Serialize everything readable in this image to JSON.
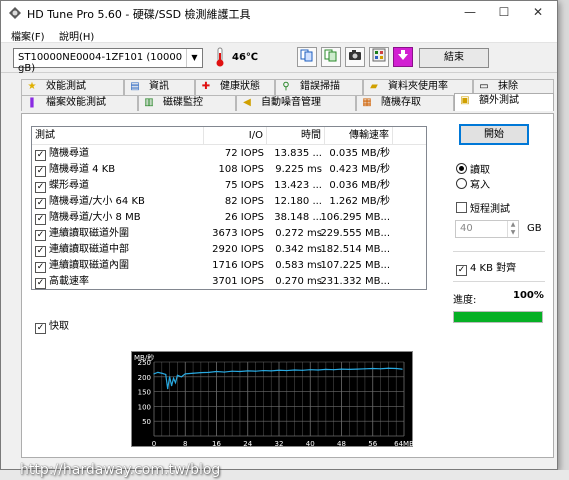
{
  "window": {
    "title": "HD Tune Pro 5.60 - 硬碟/SSD 檢測維護工具",
    "app_icon": "hdtune-icon",
    "caption_buttons": [
      "—",
      "☐",
      "✕"
    ]
  },
  "menu": [
    "檔案(F)",
    "說明(H)"
  ],
  "toolbar": {
    "drive": "ST10000NE0004-1ZF101 (10000 gB)",
    "temperature": "46℃",
    "icons": [
      "copy-info-icon",
      "copy-screenshot-icon",
      "camera-icon",
      "options-icon",
      "save-download-icon"
    ],
    "exit_label": "結束"
  },
  "tabs_row1": [
    {
      "label": "效能測試",
      "icon": "benchmark-icon"
    },
    {
      "label": "資訊",
      "icon": "info-icon"
    },
    {
      "label": "健康狀態",
      "icon": "health-icon"
    },
    {
      "label": "錯誤掃描",
      "icon": "error-scan-icon"
    },
    {
      "label": "資料夾使用率",
      "icon": "folder-usage-icon"
    },
    {
      "label": "抹除",
      "icon": "erase-icon"
    }
  ],
  "tabs_row2": [
    {
      "label": "檔案效能測試",
      "icon": "file-benchmark-icon"
    },
    {
      "label": "磁碟監控",
      "icon": "disk-monitor-icon"
    },
    {
      "label": "自動噪音管理",
      "icon": "aam-icon"
    },
    {
      "label": "隨機存取",
      "icon": "random-access-icon"
    },
    {
      "label": "額外測試",
      "icon": "extra-tests-icon",
      "active": true
    }
  ],
  "results": {
    "headers": [
      "測試",
      "I/O",
      "時間",
      "傳輸速率"
    ],
    "rows": [
      {
        "test": "隨機尋道",
        "io": "72 IOPS",
        "time": "13.835 ...",
        "rate": "0.035 MB/秒",
        "checked": true
      },
      {
        "test": "隨機尋道 4 KB",
        "io": "108 IOPS",
        "time": "9.225 ms",
        "rate": "0.423 MB/秒",
        "checked": true
      },
      {
        "test": "蝶形尋道",
        "io": "75 IOPS",
        "time": "13.423 ...",
        "rate": "0.036 MB/秒",
        "checked": true
      },
      {
        "test": "隨機尋道/大小 64 KB",
        "io": "82 IOPS",
        "time": "12.180 ...",
        "rate": "1.262 MB/秒",
        "checked": true
      },
      {
        "test": "隨機尋道/大小 8 MB",
        "io": "26 IOPS",
        "time": "38.148 ...",
        "rate": "106.295 MB...",
        "checked": true
      },
      {
        "test": "連續讀取磁道外圍",
        "io": "3673 IOPS",
        "time": "0.272 ms",
        "rate": "229.555 MB...",
        "checked": true
      },
      {
        "test": "連續讀取磁道中部",
        "io": "2920 IOPS",
        "time": "0.342 ms",
        "rate": "182.514 MB...",
        "checked": true
      },
      {
        "test": "連續讀取磁道內圍",
        "io": "1716 IOPS",
        "time": "0.583 ms",
        "rate": "107.225 MB...",
        "checked": true
      },
      {
        "test": "高載速率",
        "io": "3701 IOPS",
        "time": "0.270 ms",
        "rate": "231.332 MB...",
        "checked": true
      }
    ]
  },
  "quick": {
    "label": "快取",
    "checked": true
  },
  "controls": {
    "start_label": "開始",
    "read_label": "讀取",
    "write_label": "寫入",
    "mode": "read",
    "short_test_label": "短程測試",
    "short_test_checked": false,
    "short_test_value": "40",
    "short_test_unit": "GB",
    "align_label": "4 KB 對齊",
    "align_checked": true,
    "progress_label": "進度:",
    "progress_text": "100%",
    "progress_value": 1.0,
    "progress_color": "#06b025"
  },
  "chart_data": {
    "type": "line",
    "ylabel": "MB/秒",
    "y_ticks": [
      "250",
      "200",
      "150",
      "100",
      "50"
    ],
    "x_ticks": [
      "0",
      "8",
      "16",
      "24",
      "32",
      "40",
      "48",
      "56",
      "64MB"
    ],
    "ylim": [
      0,
      250
    ],
    "xlim": [
      0,
      64
    ],
    "line_color": "#29a9e0",
    "grid_color": "#6e6e6e",
    "background": "#000000",
    "series": [
      {
        "x": [
          0,
          1,
          2,
          3,
          3.5,
          4,
          4.5,
          5,
          5.5,
          6,
          7,
          8,
          10,
          12,
          14,
          16,
          18,
          20,
          22,
          24,
          26,
          28,
          30,
          32,
          34,
          36,
          38,
          40,
          42,
          44,
          46,
          48,
          50,
          52,
          54,
          56,
          58,
          60,
          62,
          63.5
        ],
        "y": [
          210,
          215,
          212,
          208,
          160,
          200,
          170,
          195,
          180,
          205,
          200,
          210,
          212,
          214,
          215,
          218,
          216,
          219,
          218,
          220,
          219,
          221,
          220,
          222,
          221,
          223,
          222,
          224,
          223,
          225,
          224,
          226,
          225,
          226,
          227,
          228,
          227,
          229,
          228,
          226
        ]
      }
    ]
  },
  "watermark": "http://hardaway.com.tw/blog"
}
